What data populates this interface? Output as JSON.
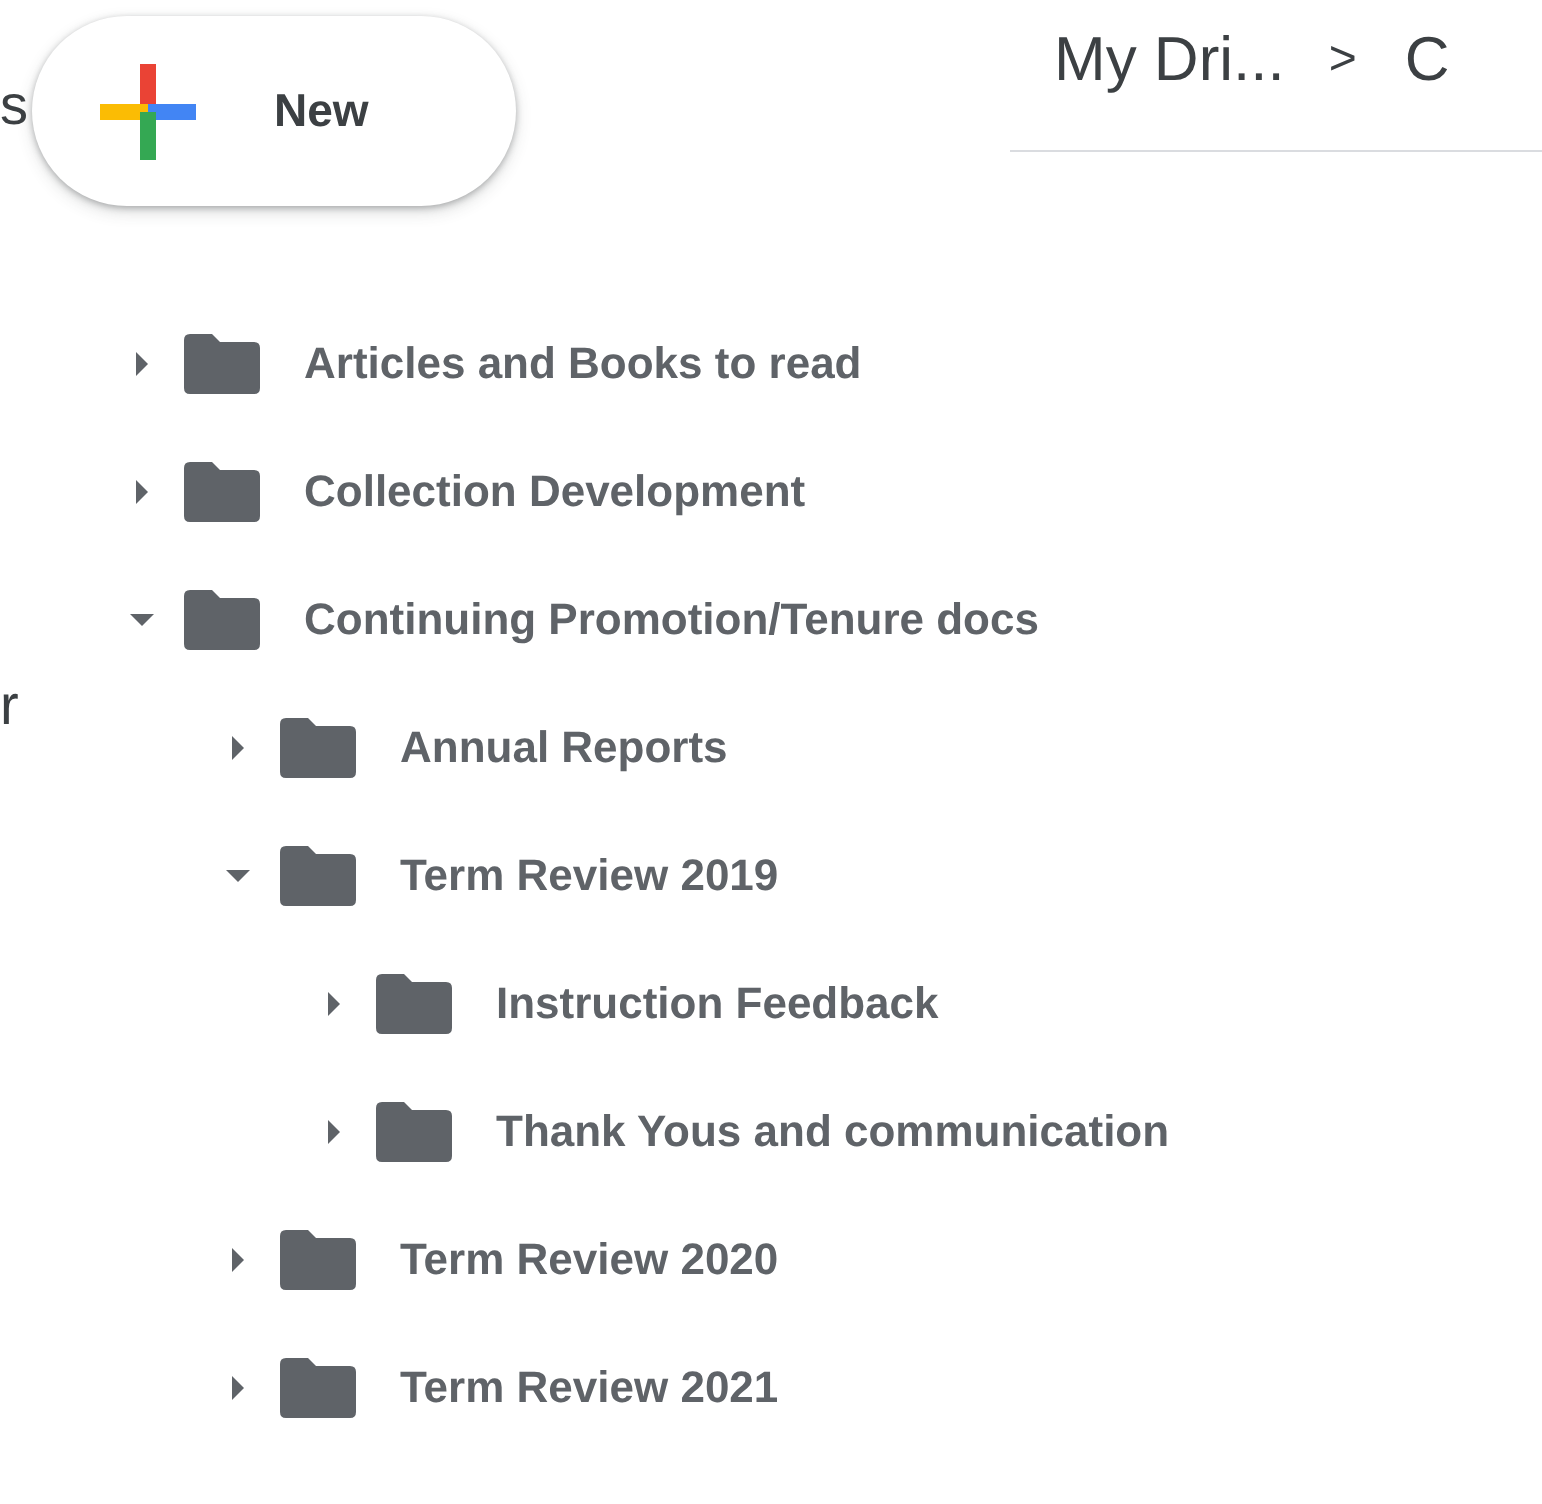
{
  "edge_fragments": [
    "s",
    "r"
  ],
  "new_button": {
    "label": "New"
  },
  "breadcrumb": {
    "items": [
      "My Dri...",
      "C"
    ],
    "separator": ">"
  },
  "tree": [
    {
      "label": "Articles and Books to read",
      "expanded": false
    },
    {
      "label": "Collection Development",
      "expanded": false
    },
    {
      "label": "Continuing Promotion/Tenure docs",
      "expanded": true,
      "children": [
        {
          "label": "Annual Reports",
          "expanded": false
        },
        {
          "label": "Term Review 2019",
          "expanded": true,
          "children": [
            {
              "label": "Instruction Feedback",
              "expanded": false
            },
            {
              "label": "Thank Yous and communication",
              "expanded": false
            }
          ]
        },
        {
          "label": "Term Review 2020",
          "expanded": false
        },
        {
          "label": "Term Review 2021",
          "expanded": false
        }
      ]
    }
  ]
}
